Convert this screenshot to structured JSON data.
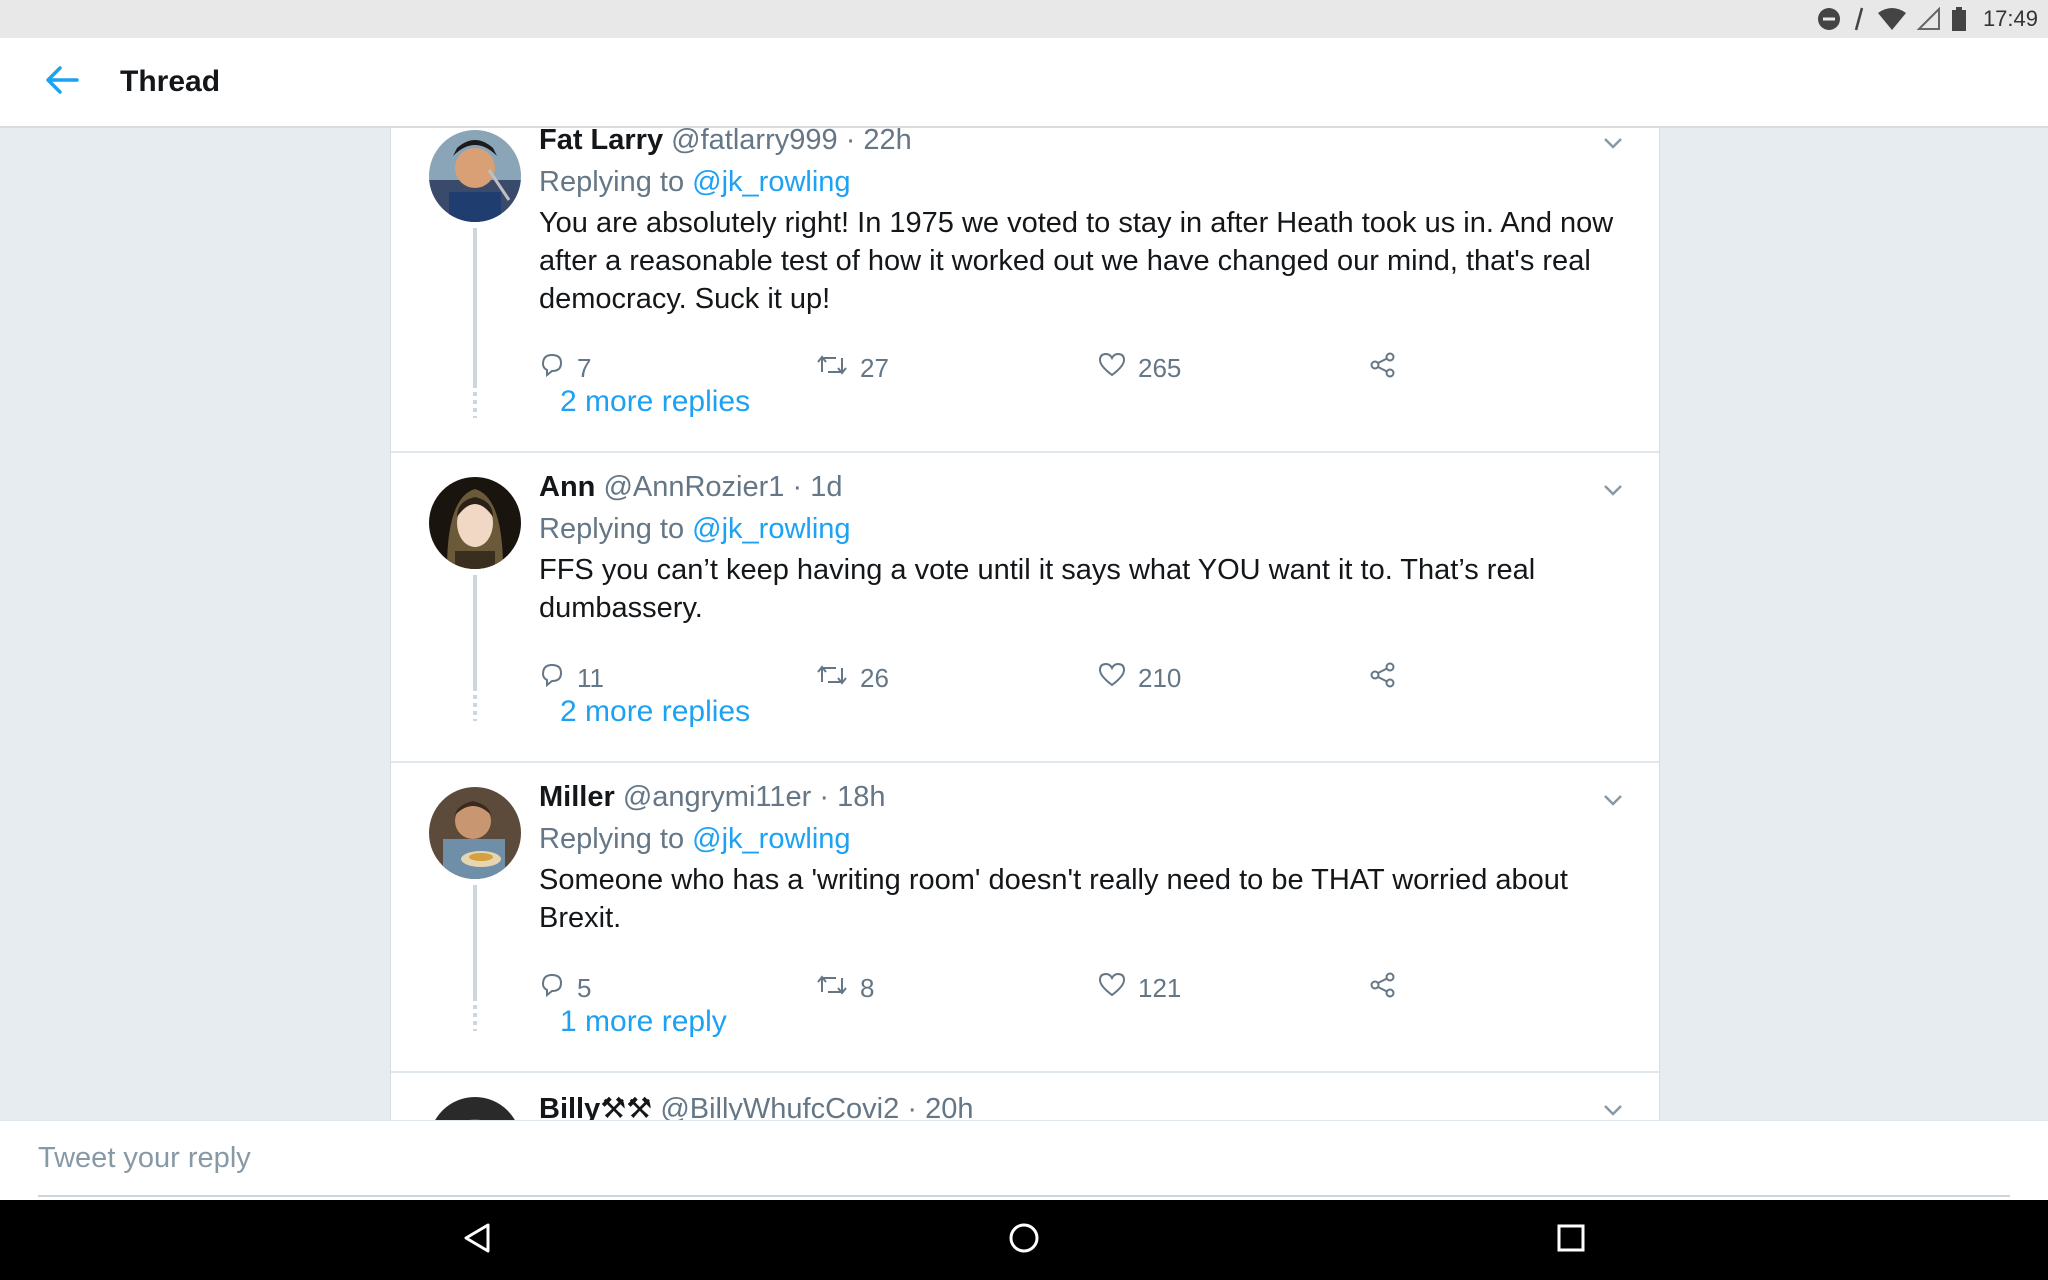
{
  "status_bar": {
    "time": "17:49",
    "icons": [
      "do-not-disturb-icon",
      "vibrate-icon",
      "wifi-icon",
      "signal-icon",
      "battery-icon"
    ]
  },
  "header": {
    "back_icon": "arrow-left-icon",
    "title": "Thread"
  },
  "colors": {
    "accent": "#1da1f2",
    "muted": "#657786",
    "background": "#e6ecf0"
  },
  "tweets": [
    {
      "name": "Fat Larry",
      "handle": "@fatlarry999",
      "time": "22h",
      "replying_prefix": "Replying to",
      "replying_to": "@jk_rowling",
      "text": "You are absolutely right!  In 1975 we voted to stay in after Heath took us in. And now after a reasonable test of how it worked out we have changed our mind, that's real democracy. Suck it up!",
      "replies": "7",
      "retweets": "27",
      "likes": "265",
      "more": "2 more replies"
    },
    {
      "name": "Ann",
      "handle": "@AnnRozier1",
      "time": "1d",
      "replying_prefix": "Replying to",
      "replying_to": "@jk_rowling",
      "text": "FFS you can’t keep having a vote until it says what YOU want it to.  That’s real dumbassery.",
      "replies": "11",
      "retweets": "26",
      "likes": "210",
      "more": "2 more replies"
    },
    {
      "name": "Miller",
      "handle": "@angrymi11er",
      "time": "18h",
      "replying_prefix": "Replying to",
      "replying_to": "@jk_rowling",
      "text": "Someone who has a 'writing room' doesn't really need to be THAT worried about Brexit.",
      "replies": "5",
      "retweets": "8",
      "likes": "121",
      "more": "1 more reply"
    },
    {
      "name": "Billy⚒⚒",
      "handle": "@BillyWhufcCovi2",
      "time": "20h"
    }
  ],
  "reply_input": {
    "placeholder": "Tweet your reply"
  },
  "nav": {
    "back_icon": "nav-back-icon",
    "home_icon": "nav-home-icon",
    "recents_icon": "nav-recents-icon"
  }
}
